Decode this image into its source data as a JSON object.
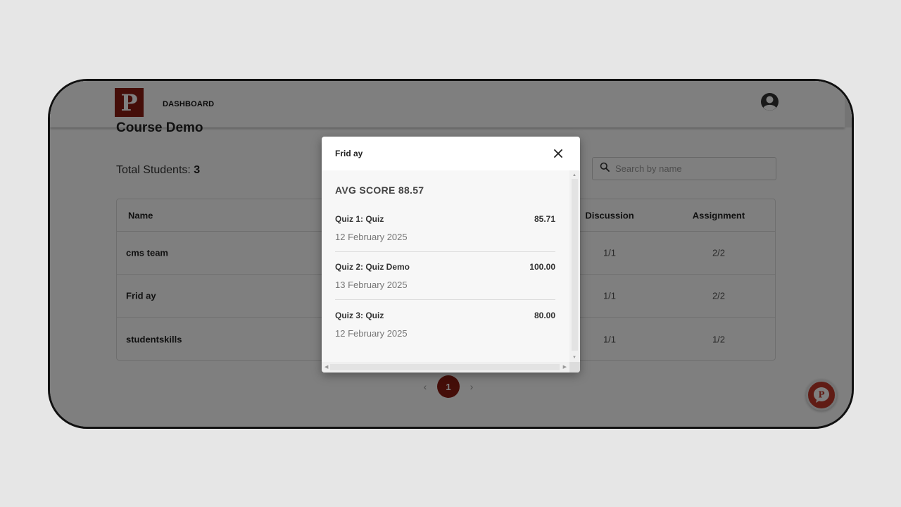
{
  "header": {
    "logo_letter": "P",
    "nav_dashboard": "DASHBOARD",
    "avatar_icon": "user-avatar-icon"
  },
  "course": {
    "title": "Course Demo",
    "total_students_label": "Total Students:",
    "total_students_value": "3"
  },
  "search": {
    "placeholder": "Search by name",
    "value": ""
  },
  "table": {
    "columns": {
      "name": "Name",
      "discussion": "Discussion",
      "assignment": "Assignment"
    },
    "rows": [
      {
        "name": "cms team",
        "discussion": "1/1",
        "assignment": "2/2"
      },
      {
        "name": "Frid ay",
        "discussion": "1/1",
        "assignment": "2/2"
      },
      {
        "name": "studentskills",
        "discussion": "1/1",
        "assignment": "1/2"
      }
    ]
  },
  "pagination": {
    "prev": "‹",
    "current": "1",
    "next": "›"
  },
  "modal": {
    "title": "Frid ay",
    "avg_score": "AVG SCORE 88.57",
    "quizzes": [
      {
        "name": "Quiz 1: Quiz",
        "score": "85.71",
        "date": "12 February 2025"
      },
      {
        "name": "Quiz 2: Quiz Demo",
        "score": "100.00",
        "date": "13 February 2025"
      },
      {
        "name": "Quiz 3: Quiz",
        "score": "80.00",
        "date": "12 February 2025"
      }
    ]
  },
  "colors": {
    "brand": "#8a1c12",
    "fab": "#c0392b"
  }
}
